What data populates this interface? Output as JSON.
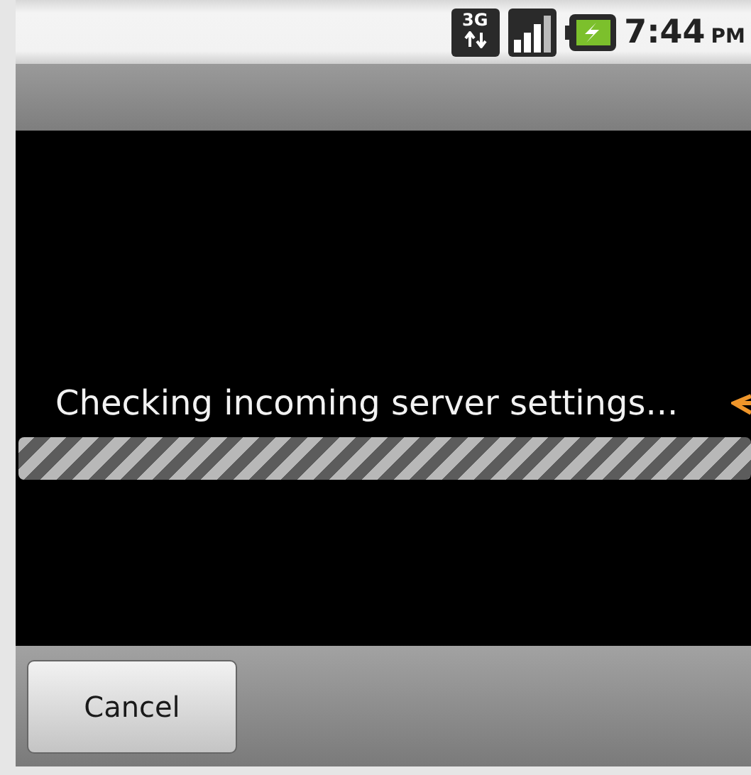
{
  "status_bar": {
    "network": "3G",
    "time": "7:44",
    "period": "PM"
  },
  "progress": {
    "message": "Checking incoming server settings...",
    "indeterminate": true
  },
  "buttons": [
    "Cancel"
  ]
}
